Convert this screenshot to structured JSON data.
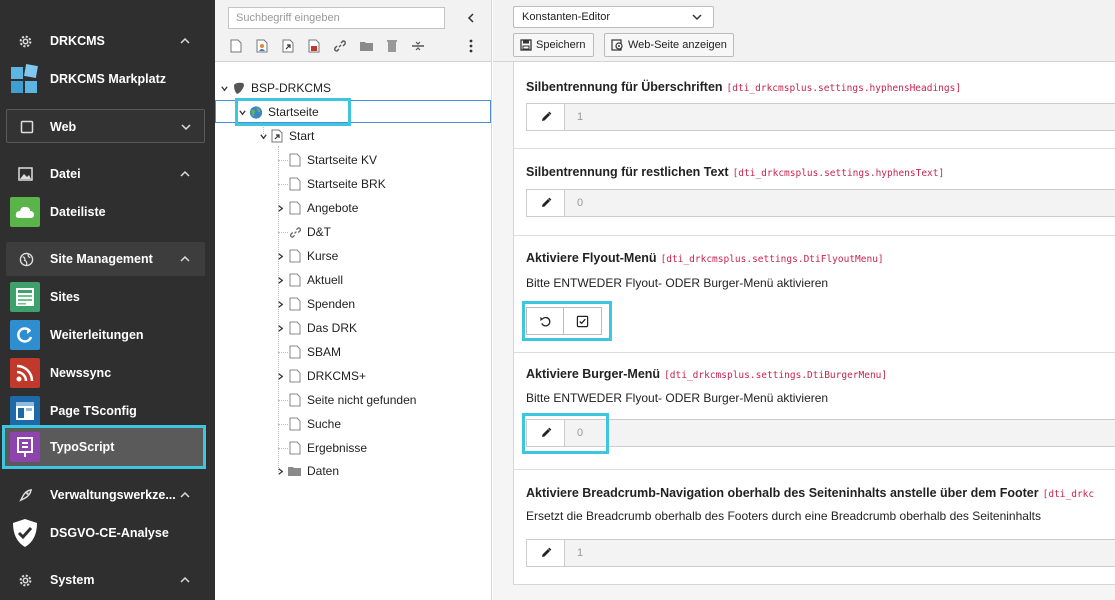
{
  "sidebar": {
    "sections": [
      {
        "label": "DRKCMS",
        "icon": "gear-icon"
      },
      {
        "label": "Web",
        "icon": "none"
      },
      {
        "label": "Datei",
        "icon": "image-icon"
      },
      {
        "label": "Site Management",
        "icon": "globe-icon"
      },
      {
        "label": "Verwaltungswerkze...",
        "icon": "rocket-icon"
      },
      {
        "label": "System",
        "icon": "gear-icon"
      }
    ],
    "items": [
      {
        "label": "DRKCMS Markplatz",
        "icon": "marketplace-icon",
        "color": "#2e8ecf"
      },
      {
        "label": "Dateiliste",
        "icon": "cloud-folder-icon",
        "color": "#5ab44a"
      },
      {
        "label": "Sites",
        "icon": "sites-icon",
        "color": "#3ea06a"
      },
      {
        "label": "Weiterleitungen",
        "icon": "redirect-icon",
        "color": "#2e8ecf"
      },
      {
        "label": "Newssync",
        "icon": "rss-icon",
        "color": "#c0392b"
      },
      {
        "label": "Page TSconfig",
        "icon": "tsconfig-icon",
        "color": "#1e6aa8"
      },
      {
        "label": "TypoScript",
        "icon": "typoscript-icon",
        "color": "#8e44ad"
      },
      {
        "label": "DSGVO-CE-Analyse",
        "icon": "shield-check-icon",
        "color": "#ffffff"
      }
    ]
  },
  "tree": {
    "search_placeholder": "Suchbegriff eingeben",
    "root": "BSP-DRKCMS",
    "selected": "Startseite",
    "start": "Start",
    "pages": [
      "Startseite KV",
      "Startseite BRK",
      "Angebote",
      "D&T",
      "Kurse",
      "Aktuell",
      "Spenden",
      "Das DRK",
      "SBAM",
      "DRKCMS+",
      "Seite nicht gefunden",
      "Suche",
      "Ergebnisse",
      "Daten"
    ]
  },
  "toolbar": {
    "mode": "Konstanten-Editor",
    "save_label": "Speichern",
    "view_label": "Web-Seite anzeigen"
  },
  "constants": [
    {
      "title": "Silbentrennung für Überschriften",
      "key": "[dti_drkcmsplus.settings.hyphensHeadings]",
      "value": "1"
    },
    {
      "title": "Silbentrennung für restlichen Text",
      "key": "[dti_drkcmsplus.settings.hyphensText]",
      "value": "0"
    },
    {
      "title": "Aktiviere Flyout-Menü",
      "key": "[dti_drkcmsplus.settings.DtiFlyoutMenu]",
      "desc": "Bitte ENTWEDER Flyout- ODER Burger-Menü aktivieren"
    },
    {
      "title": "Aktiviere Burger-Menü",
      "key": "[dti_drkcmsplus.settings.DtiBurgerMenu]",
      "desc": "Bitte ENTWEDER Flyout- ODER Burger-Menü aktivieren",
      "value": "0"
    },
    {
      "title": "Aktiviere Breadcrumb-Navigation oberhalb des Seiteninhalts anstelle über dem Footer",
      "key": "[dti_drkc",
      "desc": "Ersetzt die Breadcrumb oberhalb des Footers durch eine Breadcrumb oberhalb des Seiteninhalts",
      "value": "1"
    }
  ]
}
